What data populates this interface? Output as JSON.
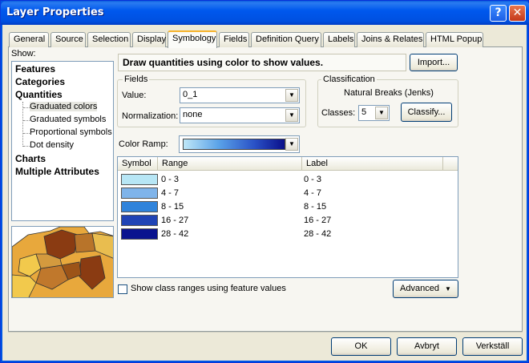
{
  "window": {
    "title": "Layer Properties"
  },
  "titlebar_buttons": {
    "help": "?",
    "close": "✕"
  },
  "tabs": [
    "General",
    "Source",
    "Selection",
    "Display",
    "Symbology",
    "Fields",
    "Definition Query",
    "Labels",
    "Joins & Relates",
    "HTML Popup"
  ],
  "active_tab": "Symbology",
  "show": {
    "label": "Show:",
    "items": {
      "features": "Features",
      "categories": "Categories",
      "quantities": "Quantities",
      "graduated_colors": "Graduated colors",
      "graduated_symbols": "Graduated symbols",
      "proportional_symbols": "Proportional symbols",
      "dot_density": "Dot density",
      "charts": "Charts",
      "multiple_attributes": "Multiple Attributes"
    },
    "selected": "Graduated colors"
  },
  "description": "Draw quantities using color to show values.",
  "import_button": "Import...",
  "fields": {
    "title": "Fields",
    "value_label": "Value:",
    "value": "0_1",
    "normalization_label": "Normalization:",
    "normalization": "none"
  },
  "classification": {
    "title": "Classification",
    "method": "Natural Breaks (Jenks)",
    "classes_label": "Classes:",
    "classes": "5",
    "classify_button": "Classify..."
  },
  "color_ramp_label": "Color Ramp:",
  "table": {
    "headers": {
      "symbol": "Symbol",
      "range": "Range",
      "label": "Label"
    },
    "rows": [
      {
        "color": "#b7e6f5",
        "range": "0 - 3",
        "label": "0 - 3"
      },
      {
        "color": "#7fb4ea",
        "range": "4 - 7",
        "label": "4 - 7"
      },
      {
        "color": "#2f83db",
        "range": "8 - 15",
        "label": "8 - 15"
      },
      {
        "color": "#1f43b5",
        "range": "16 - 27",
        "label": "16 - 27"
      },
      {
        "color": "#0a138f",
        "range": "28 - 42",
        "label": "28 - 42"
      }
    ]
  },
  "show_class_ranges": "Show class ranges using feature values",
  "advanced_button": "Advanced",
  "buttons": {
    "ok": "OK",
    "cancel": "Avbryt",
    "apply": "Verkställ"
  },
  "colors": {
    "titlebar": "#0058ee",
    "tab_highlight": "#f7b32b",
    "dialog_bg": "#ece9d8"
  }
}
